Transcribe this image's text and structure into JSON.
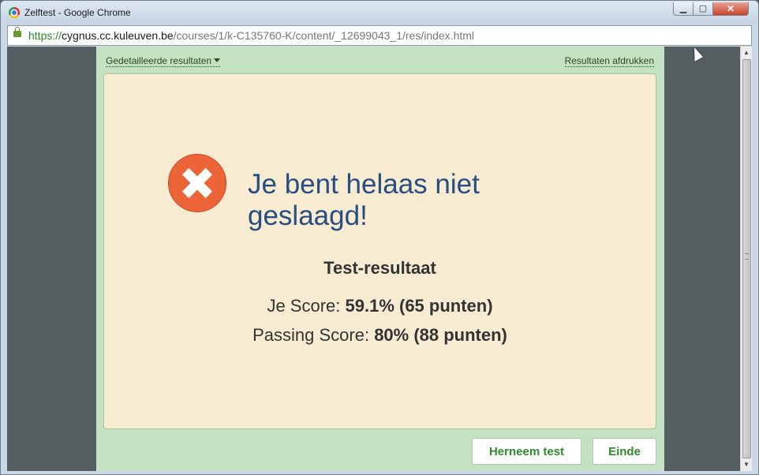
{
  "window": {
    "title": "Zelftest - Google Chrome",
    "controls": {
      "minimize": "▁",
      "maximize": "▢",
      "close": "✕"
    }
  },
  "address_bar": {
    "scheme": "https://",
    "host": "cygnus.cc.kuleuven.be",
    "path": "/courses/1/k-C135760-K/content/_12699043_1/res/index.html"
  },
  "scrollbar": {
    "up_arrow": "▲",
    "down_arrow": "▼"
  },
  "quiz": {
    "detail_link": "Gedetailleerde resultaten",
    "print_link": "Resultaten afdrukken",
    "result_message": "Je bent helaas niet geslaagd!",
    "results_title": "Test-resultaat",
    "your_score_label": "Je Score:",
    "your_score_value": "59.1% (65 punten)",
    "passing_score_label": "Passing Score:",
    "passing_score_value": "80% (88 punten)",
    "retake_button": "Herneem test",
    "end_button": "Einde"
  },
  "colors": {
    "panel_bg": "#c4e1c1",
    "card_bg": "#f7ebd2",
    "fail_icon": "#ec6437",
    "heading": "#284d80",
    "button_text": "#2f8a2b"
  },
  "icons": [
    "chrome-icon",
    "lock-icon",
    "caret-down-icon",
    "fail-x-icon",
    "cursor-icon"
  ]
}
